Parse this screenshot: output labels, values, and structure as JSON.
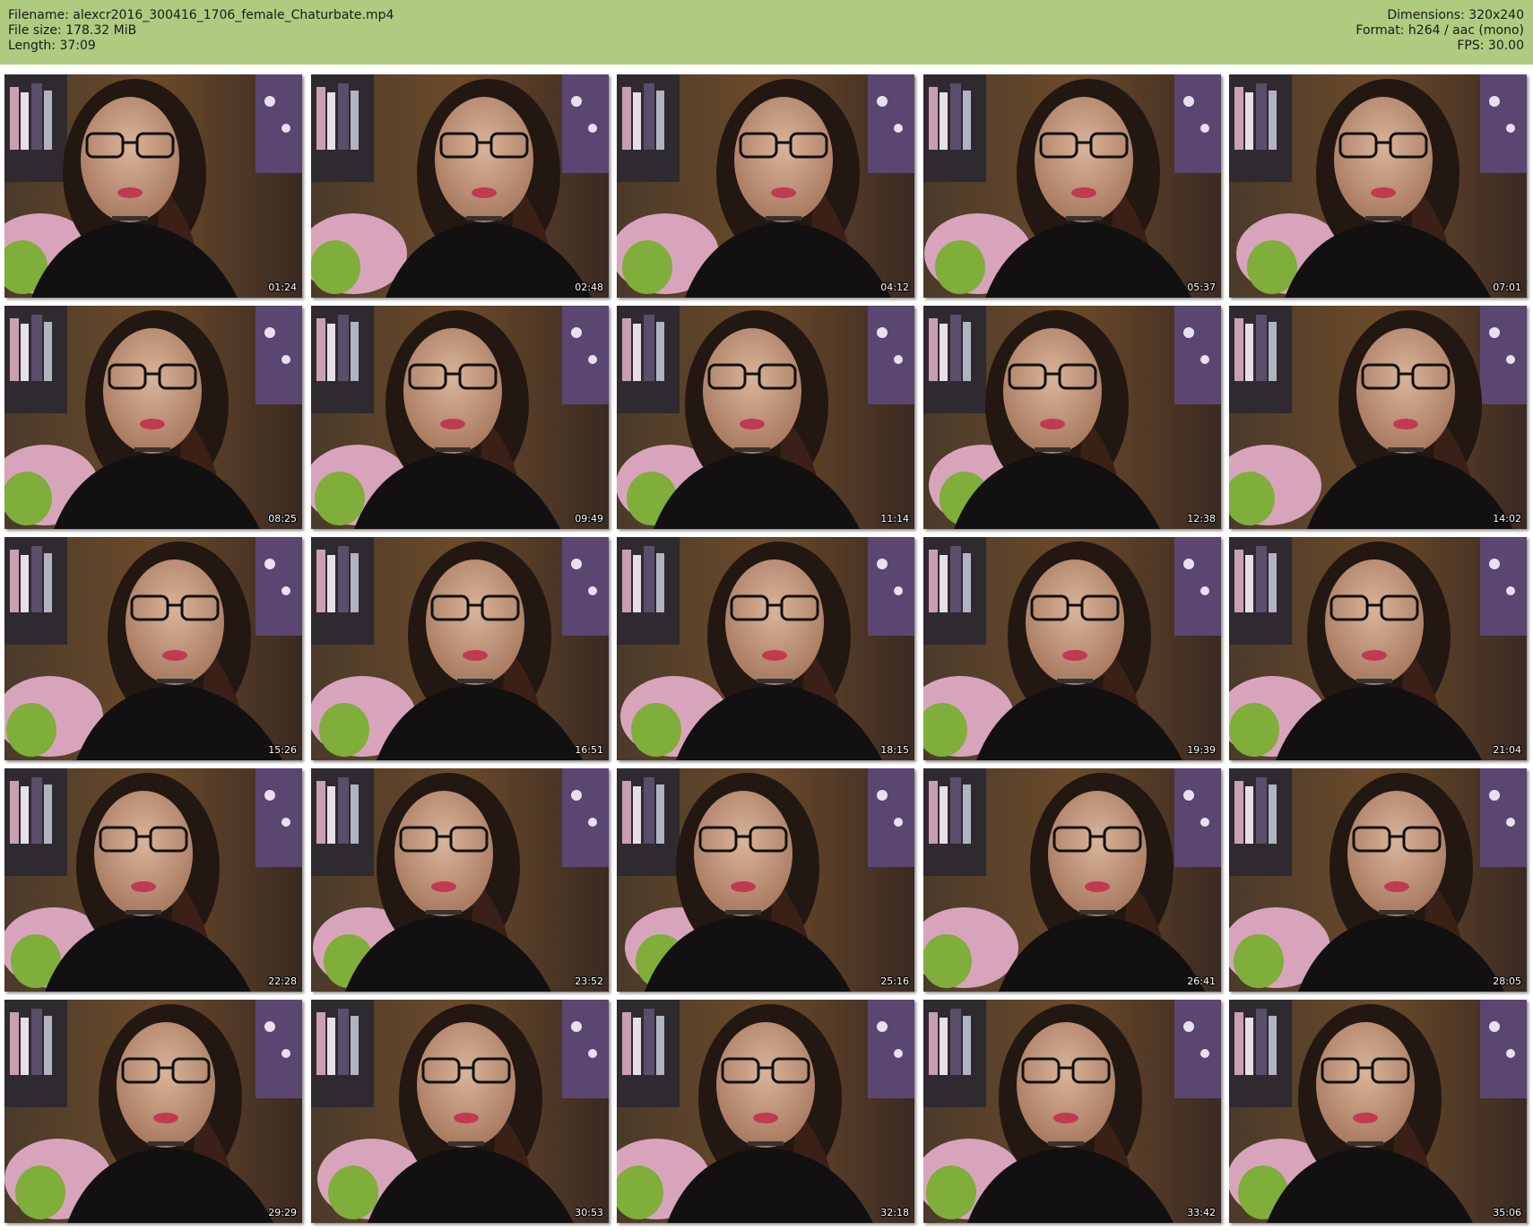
{
  "header": {
    "filename_line": "Filename: alexcr2016_300416_1706_female_Chaturbate.mp4",
    "filesize_line": "File size: 178.32 MiB",
    "length_line": "Length: 37:09",
    "dimensions_line": "Dimensions: 320x240",
    "format_line": "Format: h264 / aac (mono)",
    "fps_line": "FPS: 30.00"
  },
  "colors": {
    "header_bg": "#aecb80",
    "page_bg": "#ffffff"
  },
  "thumbnails": [
    {
      "time": "01:24"
    },
    {
      "time": "02:48"
    },
    {
      "time": "04:12"
    },
    {
      "time": "05:37"
    },
    {
      "time": "07:01"
    },
    {
      "time": "08:25"
    },
    {
      "time": "09:49"
    },
    {
      "time": "11:14"
    },
    {
      "time": "12:38"
    },
    {
      "time": "14:02"
    },
    {
      "time": "15:26"
    },
    {
      "time": "16:51"
    },
    {
      "time": "18:15"
    },
    {
      "time": "19:39"
    },
    {
      "time": "21:04"
    },
    {
      "time": "22:28"
    },
    {
      "time": "23:52"
    },
    {
      "time": "25:16"
    },
    {
      "time": "26:41"
    },
    {
      "time": "28:05"
    },
    {
      "time": "29:29"
    },
    {
      "time": "30:53"
    },
    {
      "time": "32:18"
    },
    {
      "time": "33:42"
    },
    {
      "time": "35:06"
    }
  ]
}
